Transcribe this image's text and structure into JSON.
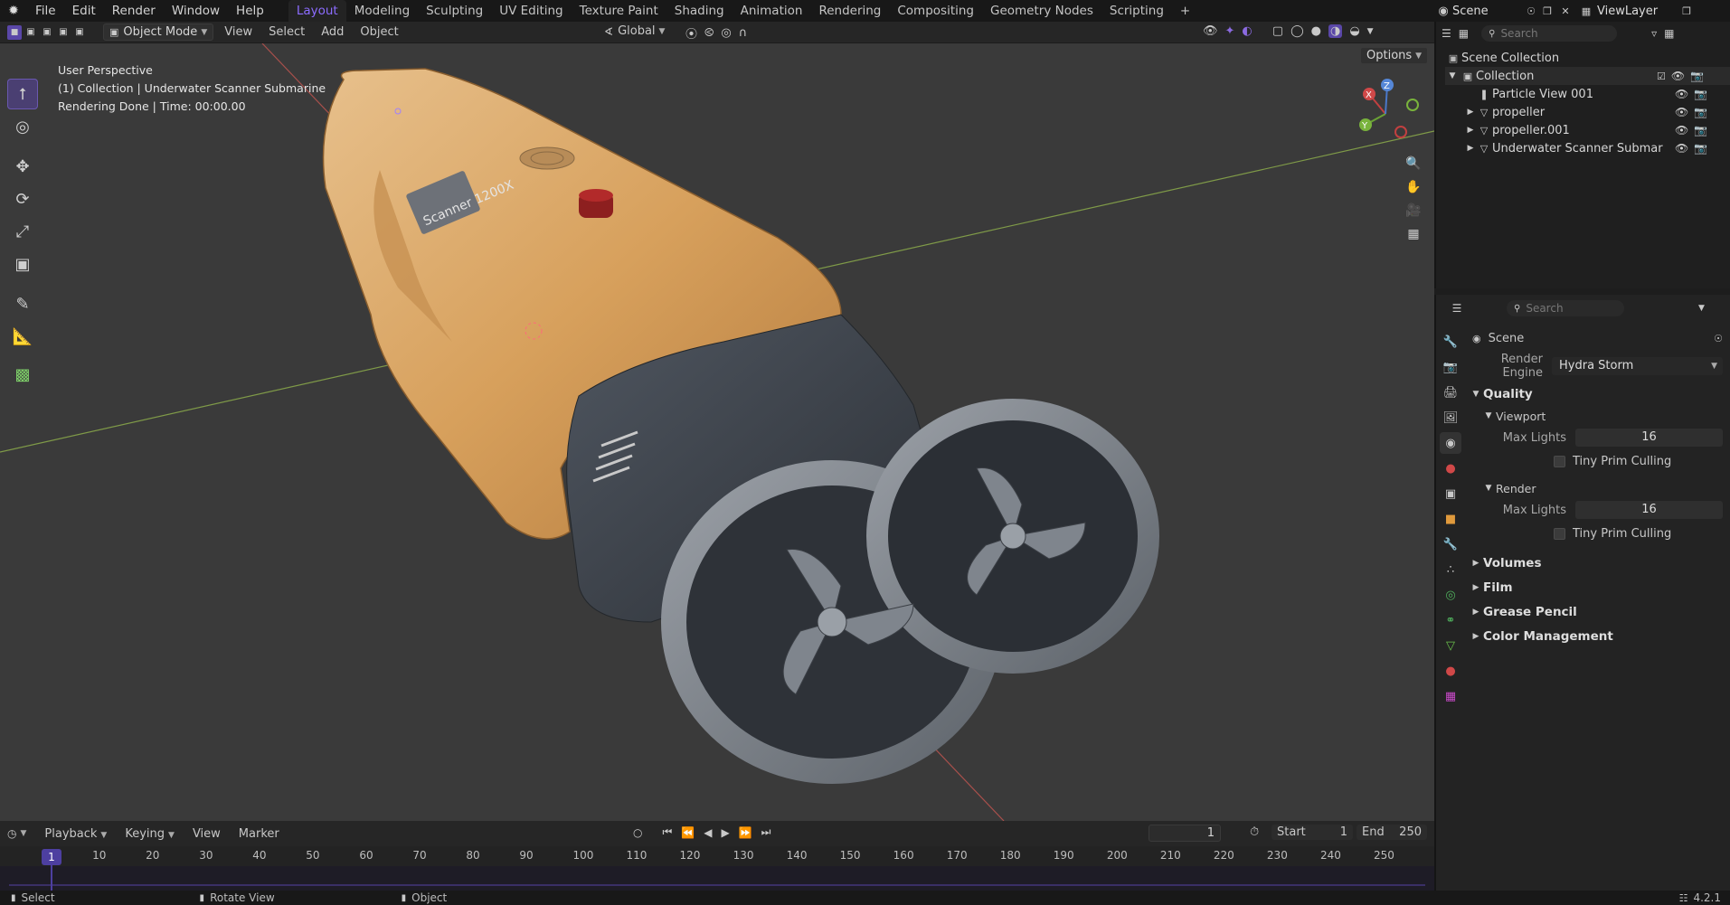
{
  "topbar": {
    "menus": [
      "File",
      "Edit",
      "Render",
      "Window",
      "Help"
    ],
    "workspaces": [
      "Layout",
      "Modeling",
      "Sculpting",
      "UV Editing",
      "Texture Paint",
      "Shading",
      "Animation",
      "Rendering",
      "Compositing",
      "Geometry Nodes",
      "Scripting"
    ],
    "active_workspace": "Layout",
    "add_tab": "+",
    "scene": "Scene",
    "view_layer": "ViewLayer"
  },
  "viewport_header": {
    "mode": "Object Mode",
    "menus": [
      "View",
      "Select",
      "Add",
      "Object"
    ],
    "orientation": "Global",
    "options": "Options"
  },
  "viewport": {
    "info": [
      "User Perspective",
      "(1) Collection | Underwater Scanner Submarine",
      "Rendering Done | Time: 00:00.00"
    ],
    "hull_text": "Scanner 1200X",
    "gizmo": {
      "x": "X",
      "y": "Y",
      "z": "Z"
    }
  },
  "outliner": {
    "search_placeholder": "Search",
    "root": "Scene Collection",
    "collection": "Collection",
    "items": [
      "Particle View 001",
      "propeller",
      "propeller.001",
      "Underwater Scanner Submar"
    ]
  },
  "properties": {
    "search_placeholder": "Search",
    "context": "Scene",
    "render_engine_label": "Render Engine",
    "render_engine": "Hydra Storm",
    "quality": "Quality",
    "viewport": "Viewport",
    "max_lights_label": "Max Lights",
    "viewport_max_lights": "16",
    "tiny_prim": "Tiny Prim Culling",
    "render": "Render",
    "render_max_lights": "16",
    "sections": [
      "Volumes",
      "Film",
      "Grease Pencil",
      "Color Management"
    ]
  },
  "timeline": {
    "menus": [
      "Playback",
      "Keying",
      "View",
      "Marker"
    ],
    "current_frame": "1",
    "start_label": "Start",
    "start": "1",
    "end_label": "End",
    "end": "250",
    "ticks": [
      "1",
      "10",
      "20",
      "30",
      "40",
      "50",
      "60",
      "70",
      "80",
      "90",
      "100",
      "110",
      "120",
      "130",
      "140",
      "150",
      "160",
      "170",
      "180",
      "190",
      "200",
      "210",
      "220",
      "230",
      "240",
      "250"
    ]
  },
  "statusbar": {
    "select": "Select",
    "rotate": "Rotate View",
    "object": "Object",
    "version": "4.2.1"
  }
}
